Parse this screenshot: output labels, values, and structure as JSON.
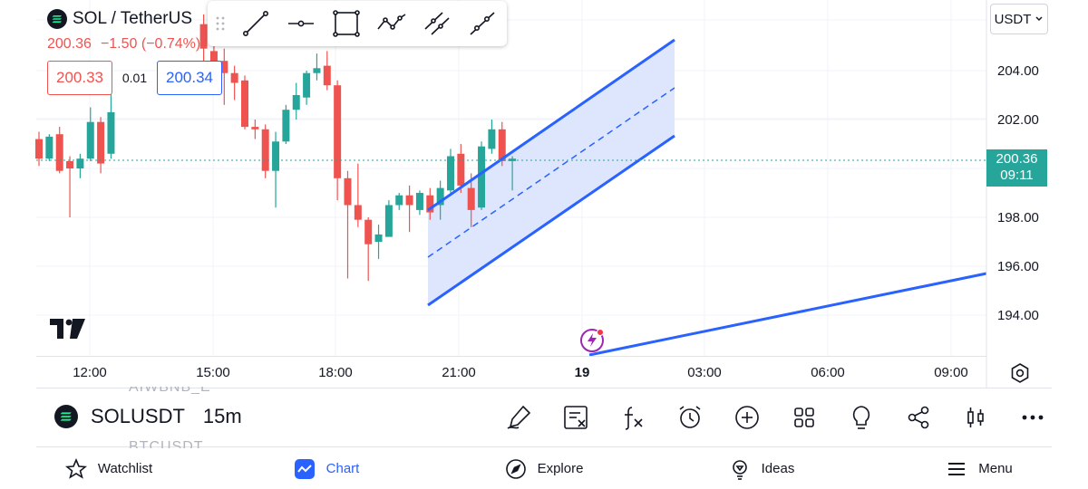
{
  "header": {
    "symbol_title": "SOL / TetherUS",
    "last_price": "200.36",
    "change": "−1.50 (−0.74%)",
    "bid": "200.33",
    "spread": "0.01",
    "ask": "200.34",
    "currency": "USDT"
  },
  "toolbar": {
    "tools": [
      "trend-line-icon",
      "horizontal-ray-icon",
      "rectangle-icon",
      "path-icon",
      "parallel-channel-icon",
      "ray-line-icon"
    ]
  },
  "chart_data": {
    "type": "candlestick",
    "ylim": [
      192.6,
      206.4
    ],
    "y_ticks": [
      "204.00",
      "202.00",
      "198.00",
      "196.00",
      "194.00"
    ],
    "y_tick_values": [
      204,
      202,
      198,
      196,
      194
    ],
    "x_ticks": [
      "12:00",
      "15:00",
      "18:00",
      "21:00",
      "19",
      "03:00",
      "06:00",
      "09:00"
    ],
    "x_tick_bold": [
      false,
      false,
      false,
      false,
      true,
      false,
      false,
      false
    ],
    "last_price_label": "200.36",
    "countdown": "09:11",
    "candles": [
      {
        "t": 0,
        "o": 201.2,
        "h": 201.5,
        "c": 200.4,
        "l": 200.1
      },
      {
        "t": 1,
        "o": 200.4,
        "h": 201.4,
        "c": 201.3,
        "l": 200.3
      },
      {
        "t": 2,
        "o": 201.4,
        "h": 201.7,
        "c": 199.9,
        "l": 199.8
      },
      {
        "t": 3,
        "o": 200.3,
        "h": 200.5,
        "c": 200.0,
        "l": 198.0
      },
      {
        "t": 4,
        "o": 200.0,
        "h": 200.6,
        "c": 200.4,
        "l": 199.6
      },
      {
        "t": 5,
        "o": 200.4,
        "h": 202.5,
        "c": 201.9,
        "l": 200.3
      },
      {
        "t": 6,
        "o": 201.9,
        "h": 202.1,
        "c": 200.2,
        "l": 199.8
      },
      {
        "t": 7,
        "o": 200.6,
        "h": 203.6,
        "c": 202.3,
        "l": 200.4
      },
      {
        "t": 16,
        "o": 205.9,
        "h": 206.3,
        "c": 204.9,
        "l": 204.2
      },
      {
        "t": 17,
        "o": 204.8,
        "h": 205.3,
        "c": 204.3,
        "l": 203.8
      },
      {
        "t": 18,
        "o": 204.4,
        "h": 204.9,
        "c": 203.9,
        "l": 202.6
      },
      {
        "t": 19,
        "o": 203.9,
        "h": 204.2,
        "c": 203.5,
        "l": 202.8
      },
      {
        "t": 20,
        "o": 203.6,
        "h": 203.8,
        "c": 201.7,
        "l": 201.6
      },
      {
        "t": 21,
        "o": 201.7,
        "h": 202.0,
        "c": 201.6,
        "l": 201.2
      },
      {
        "t": 22,
        "o": 201.6,
        "h": 201.8,
        "c": 199.9,
        "l": 199.6
      },
      {
        "t": 23,
        "o": 199.9,
        "h": 201.5,
        "c": 201.1,
        "l": 198.4
      },
      {
        "t": 24,
        "o": 201.1,
        "h": 202.6,
        "c": 202.4,
        "l": 201.0
      },
      {
        "t": 25,
        "o": 202.4,
        "h": 203.5,
        "c": 203.0,
        "l": 202.0
      },
      {
        "t": 26,
        "o": 202.9,
        "h": 204.0,
        "c": 203.9,
        "l": 202.6
      },
      {
        "t": 27,
        "o": 203.9,
        "h": 204.7,
        "c": 204.1,
        "l": 203.6
      },
      {
        "t": 28,
        "o": 204.2,
        "h": 204.8,
        "c": 203.4,
        "l": 203.2
      },
      {
        "t": 29,
        "o": 203.4,
        "h": 203.6,
        "c": 199.6,
        "l": 198.7
      },
      {
        "t": 30,
        "o": 199.6,
        "h": 199.9,
        "c": 198.5,
        "l": 195.5
      },
      {
        "t": 31,
        "o": 198.5,
        "h": 200.2,
        "c": 197.9,
        "l": 197.6
      },
      {
        "t": 32,
        "o": 197.9,
        "h": 198.0,
        "c": 196.9,
        "l": 195.4
      },
      {
        "t": 33,
        "o": 197.0,
        "h": 197.7,
        "c": 197.3,
        "l": 196.3
      },
      {
        "t": 34,
        "o": 197.2,
        "h": 198.7,
        "c": 198.5,
        "l": 197.6
      },
      {
        "t": 35,
        "o": 198.5,
        "h": 199.0,
        "c": 198.9,
        "l": 198.3
      },
      {
        "t": 36,
        "o": 198.9,
        "h": 199.3,
        "c": 198.5,
        "l": 197.4
      },
      {
        "t": 37,
        "o": 198.3,
        "h": 199.1,
        "c": 199.0,
        "l": 198.1
      },
      {
        "t": 38,
        "o": 198.9,
        "h": 199.2,
        "c": 198.2,
        "l": 197.9
      },
      {
        "t": 39,
        "o": 198.5,
        "h": 199.5,
        "c": 199.2,
        "l": 197.9
      },
      {
        "t": 40,
        "o": 199.1,
        "h": 200.8,
        "c": 200.5,
        "l": 199.0
      },
      {
        "t": 41,
        "o": 200.6,
        "h": 201.0,
        "c": 199.3,
        "l": 199.0
      },
      {
        "t": 42,
        "o": 199.2,
        "h": 199.8,
        "c": 198.3,
        "l": 197.6
      },
      {
        "t": 43,
        "o": 198.4,
        "h": 201.1,
        "c": 200.9,
        "l": 198.3
      },
      {
        "t": 44,
        "o": 200.8,
        "h": 202.0,
        "c": 201.6,
        "l": 200.6
      },
      {
        "t": 45,
        "o": 201.6,
        "h": 201.9,
        "c": 200.3,
        "l": 200.1
      },
      {
        "t": 46,
        "o": 200.3,
        "h": 200.5,
        "c": 200.4,
        "l": 199.1
      }
    ]
  },
  "bottom_bar": {
    "ghost_prev": "AIWBNB_E",
    "symbol": "SOLUSDT",
    "interval": "15m",
    "ghost_next": "BTCUSDT",
    "actions": [
      "draw-pen-icon",
      "clear-drawings-icon",
      "indicators-fx-icon",
      "alarm-icon",
      "add-icon",
      "layouts-icon",
      "ideas-bulb-icon",
      "share-icon",
      "candles-style-icon",
      "more-icon"
    ]
  },
  "nav": {
    "items": [
      {
        "label": "Watchlist",
        "icon": "star-icon"
      },
      {
        "label": "Chart",
        "icon": "chart-icon"
      },
      {
        "label": "Explore",
        "icon": "compass-icon"
      },
      {
        "label": "Ideas",
        "icon": "lightbulb-icon"
      },
      {
        "label": "Menu",
        "icon": "hamburger-icon"
      }
    ]
  },
  "colors": {
    "up": "#26a69a",
    "down": "#ef5350",
    "drawing": "#2962ff",
    "channel_fill": "#d7e2fb",
    "grid": "#f0f3fa"
  }
}
